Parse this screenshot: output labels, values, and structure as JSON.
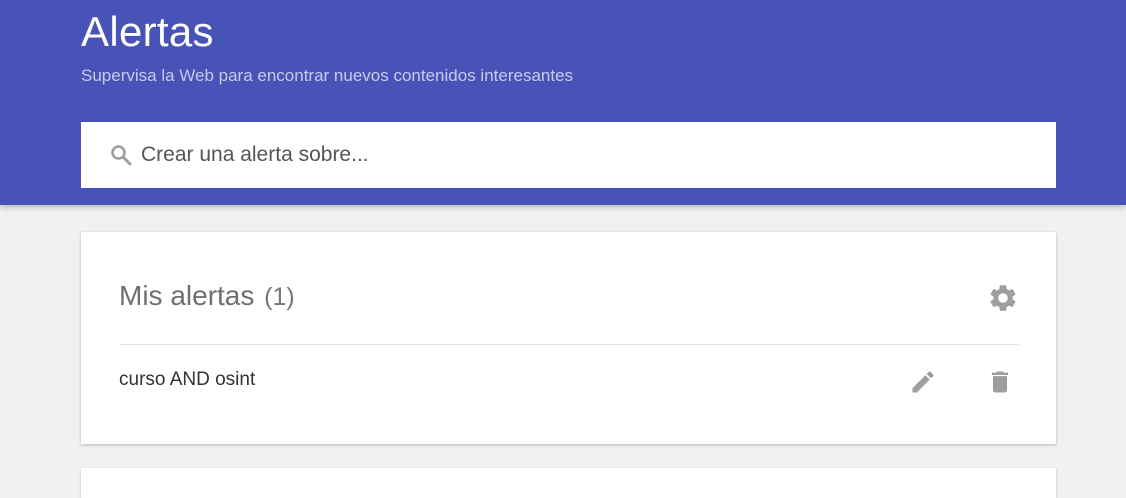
{
  "header": {
    "title": "Alertas",
    "subtitle": "Supervisa la Web para encontrar nuevos contenidos interesantes"
  },
  "search": {
    "placeholder": "Crear una alerta sobre...",
    "value": ""
  },
  "alerts_card": {
    "title": "Mis alertas",
    "count": "(1)",
    "items": [
      {
        "label": "curso AND osint"
      }
    ]
  },
  "icons": {
    "search": "search-icon",
    "settings": "gear-icon",
    "edit": "pencil-icon",
    "delete": "trash-icon"
  },
  "colors": {
    "header_bg": "#4753b7",
    "page_bg": "#f1f1f1",
    "icon_gray": "#9e9e9e"
  }
}
